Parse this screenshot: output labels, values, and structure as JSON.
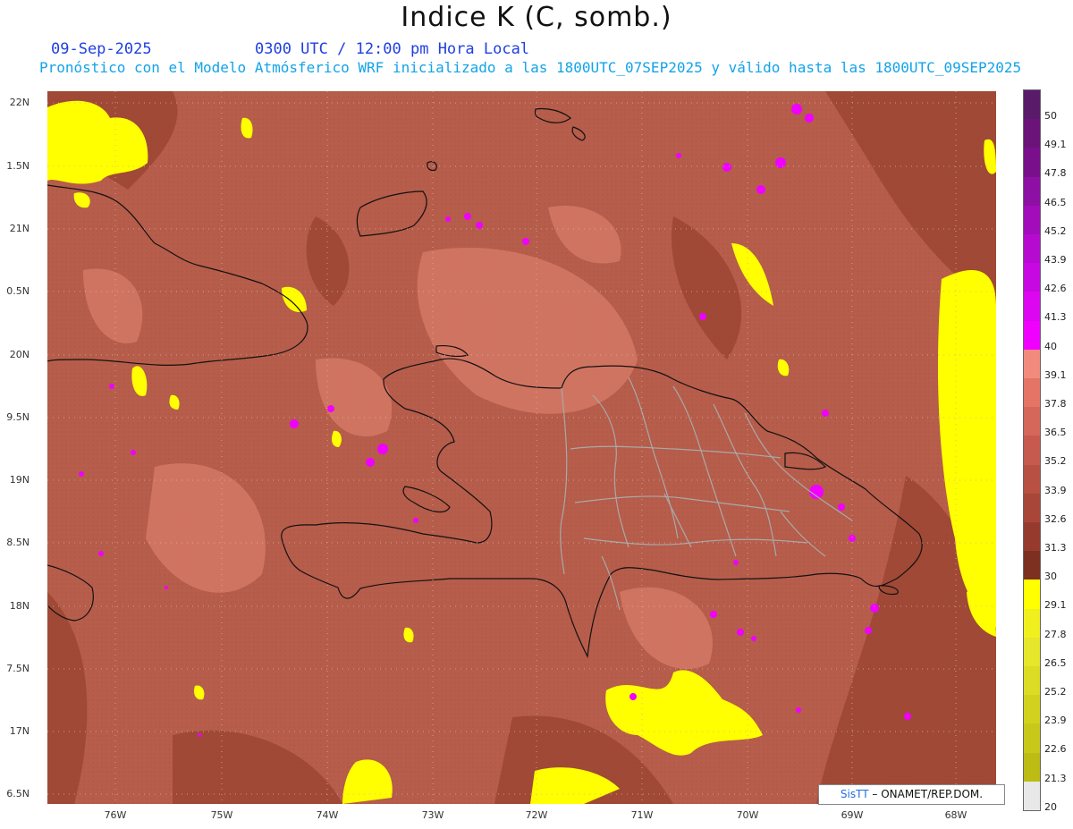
{
  "header": {
    "title": "Indice K (C, somb.)",
    "date": "09-Sep-2025",
    "time": "0300 UTC / 12:00 pm Hora Local",
    "subtitle": "Pronóstico con el Modelo Atmósferico WRF inicializado a las 1800UTC_07SEP2025 y válido hasta las  1800UTC_09SEP2025"
  },
  "map": {
    "lat_labels": [
      "22N",
      "1.5N",
      "21N",
      "0.5N",
      "20N",
      "9.5N",
      "19N",
      "8.5N",
      "18N",
      "7.5N",
      "17N",
      "6.5N"
    ],
    "lon_labels": [
      "76W",
      "75W",
      "74W",
      "73W",
      "72W",
      "71W",
      "70W",
      "69W",
      "68W"
    ],
    "credit_prefix": "SisTT",
    "credit_suffix": "– ONAMET/REP.DOM."
  },
  "colorbar": {
    "labels": [
      "50",
      "49.1",
      "47.8",
      "46.5",
      "45.2",
      "43.9",
      "42.6",
      "41.3",
      "40",
      "39.1",
      "37.8",
      "36.5",
      "35.2",
      "33.9",
      "32.6",
      "31.3",
      "30",
      "29.1",
      "27.8",
      "26.5",
      "25.2",
      "23.9",
      "22.6",
      "21.3",
      "20"
    ],
    "colors": [
      "#5a1a6a",
      "#6b1379",
      "#7a0f8c",
      "#8e0fa3",
      "#a20cba",
      "#b60ad0",
      "#c808e2",
      "#dc06f0",
      "#f000ff",
      "#f28a7e",
      "#e47466",
      "#d4665a",
      "#c65a4e",
      "#b85044",
      "#a8463a",
      "#963a2e",
      "#7e3020",
      "#ffff00",
      "#f0f01e",
      "#e6e62a",
      "#dcdc24",
      "#d2d21e",
      "#c8c81a",
      "#bcbc14",
      "#e8e8e8"
    ]
  }
}
